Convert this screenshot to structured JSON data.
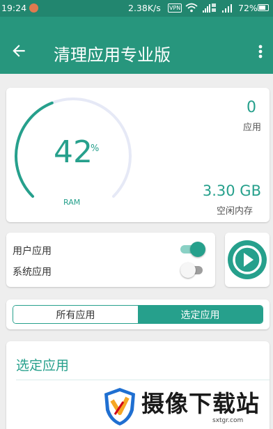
{
  "status_bar": {
    "time": "19:24",
    "net_speed": "2.38K/s",
    "vpn": "VPN",
    "battery": "72%",
    "icons": [
      "notification-icon",
      "wifi-icon",
      "signal-icon",
      "battery-icon"
    ]
  },
  "app_bar": {
    "title": "清理应用专业版",
    "back_icon": "arrow-left-icon",
    "menu_icon": "more-vert-icon",
    "color": "#27967d"
  },
  "ram_card": {
    "percent": "42",
    "percent_value": 42,
    "percent_sign": "%",
    "ram_label": "RAM",
    "apps_count": "0",
    "apps_label": "应用",
    "free_memory": "3.30 GB",
    "free_memory_label": "空闲内存"
  },
  "filters": {
    "user_apps": {
      "label": "用户应用",
      "on": true
    },
    "system_apps": {
      "label": "系统应用",
      "on": false
    }
  },
  "play_button": {
    "icon": "play-icon"
  },
  "tabs": {
    "all": "所有应用",
    "selected": "选定应用",
    "active": "selected"
  },
  "list_card": {
    "heading": "选定应用"
  },
  "watermark": {
    "title": "摄像下载站",
    "url": "sxtgr.com"
  },
  "colors": {
    "accent": "#26a08c",
    "toolbar": "#27967d",
    "status_bar": "#22866f",
    "background": "#eeeeee"
  }
}
